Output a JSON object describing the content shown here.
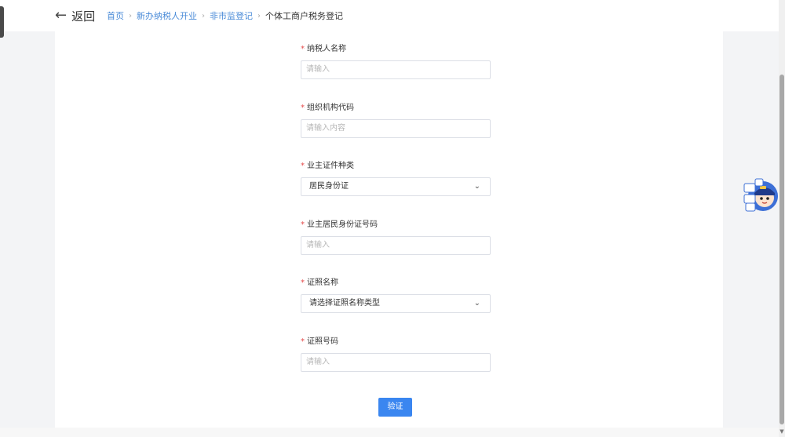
{
  "header": {
    "back_label": "返回",
    "breadcrumb": {
      "items": [
        "首页",
        "新办纳税人开业",
        "非市监登记"
      ],
      "current": "个体工商户税务登记"
    }
  },
  "form": {
    "required_mark": "*",
    "taxpayer_name": {
      "label": "纳税人名称",
      "placeholder": "请输入"
    },
    "org_code": {
      "label": "组织机构代码",
      "placeholder": "请输入内容"
    },
    "owner_cert_type": {
      "label": "业主证件种类",
      "value": "居民身份证"
    },
    "owner_id_number": {
      "label": "业主居民身份证号码",
      "placeholder": "请输入"
    },
    "license_name": {
      "label": "证照名称",
      "value": "请选择证照名称类型"
    },
    "license_number": {
      "label": "证照号码",
      "placeholder": "请输入"
    },
    "submit_label": "验证"
  },
  "mascot": {
    "icon": "tax-mascot-icon"
  },
  "colors": {
    "accent": "#3a86f0",
    "link": "#4a8bd8",
    "required": "#e54b4b"
  }
}
